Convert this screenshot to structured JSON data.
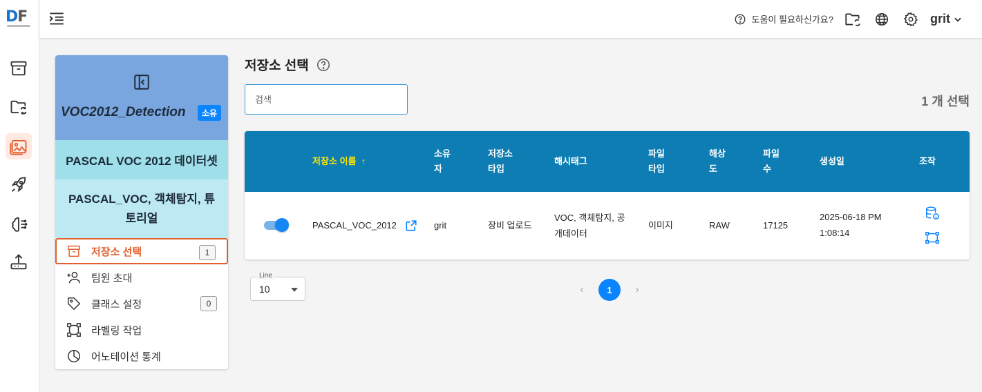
{
  "app": {
    "logo_d": "D",
    "logo_f": "F"
  },
  "topbar": {
    "help_text": "도움이 필요하신가요?",
    "user": "grit"
  },
  "project": {
    "title": "VOC2012_Detection",
    "badge": "소유",
    "name": "PASCAL VOC 2012 데이터셋",
    "tags": "PASCAL_VOC, 객체탐지, 튜토리얼",
    "nav": [
      {
        "label": "저장소 선택",
        "count": "1",
        "active": true
      },
      {
        "label": "팀원 초대"
      },
      {
        "label": "클래스 설정",
        "count": "0"
      },
      {
        "label": "라벨링 작업"
      },
      {
        "label": "어노테이션 통계"
      }
    ]
  },
  "main": {
    "title": "저장소 선택",
    "search_placeholder": "검색",
    "selected_count": "1 개 선택"
  },
  "table": {
    "headers": {
      "name": "저장소 이름",
      "owner": [
        "소유",
        "자"
      ],
      "type": [
        "저장소",
        "타입"
      ],
      "hashtag": "해시태그",
      "file_type": [
        "파일",
        "타입"
      ],
      "resolution": [
        "해상",
        "도"
      ],
      "file_count": [
        "파일",
        "수"
      ],
      "created": "생성일",
      "actions": "조작"
    },
    "rows": [
      {
        "enabled": true,
        "name": "PASCAL_VOC_2012",
        "owner": "grit",
        "type": "장비 업로드",
        "hashtag": [
          "VOC, 객체탐지, 공",
          "개데이터"
        ],
        "file_type": "이미지",
        "resolution": "RAW",
        "file_count": "17125",
        "created": [
          "2025-06-18 PM",
          "1:08:14"
        ]
      }
    ]
  },
  "pagination": {
    "line_label": "Line",
    "line_value": "10",
    "current_page": "1",
    "prev": "‹",
    "next": "›"
  },
  "colors": {
    "accent": "#0a84ff",
    "header": "#0e7db3",
    "active_nav": "#e0602f",
    "sort_header": "#ffe600"
  }
}
